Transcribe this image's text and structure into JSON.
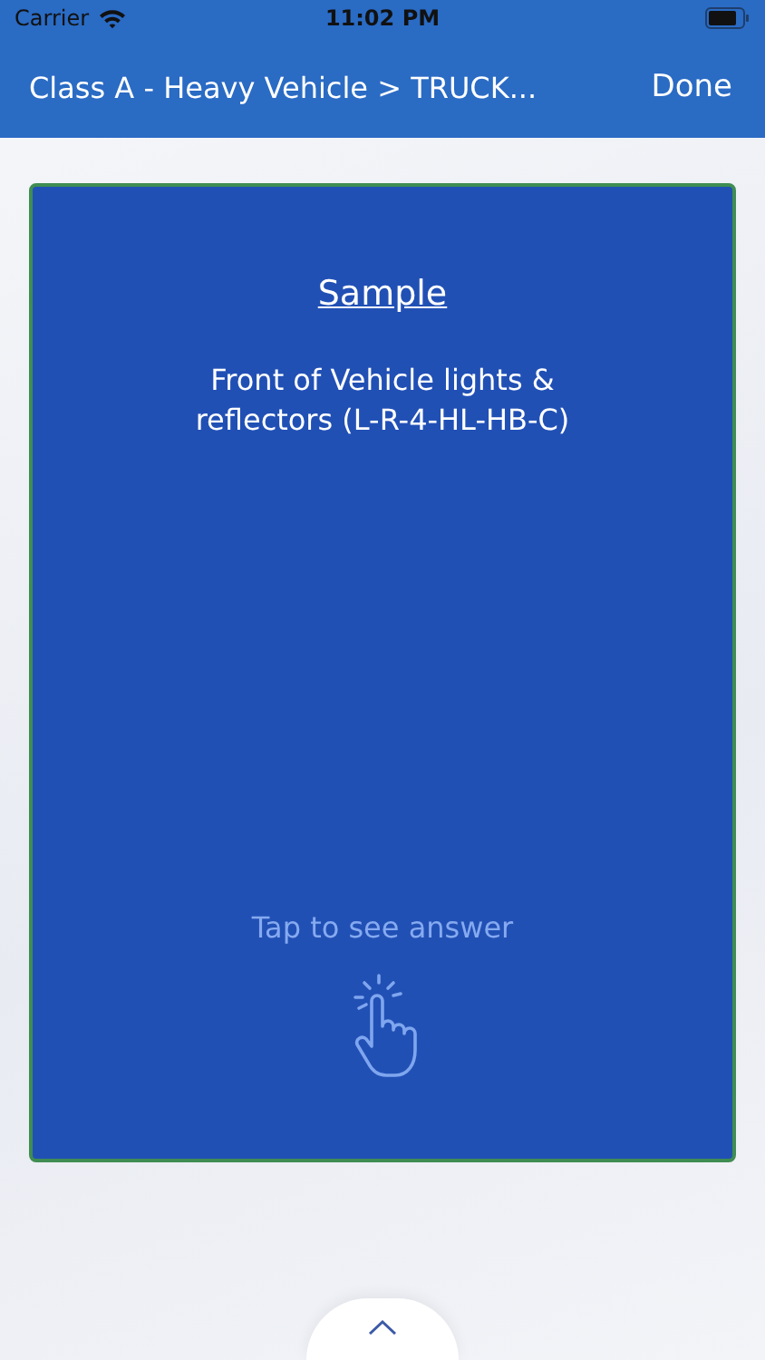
{
  "status_bar": {
    "carrier": "Carrier",
    "time": "11:02 PM"
  },
  "nav_bar": {
    "title": "Class A - Heavy Vehicle > TRUCK...",
    "done": "Done"
  },
  "card": {
    "heading": "Sample",
    "question": "Front of Vehicle lights & reflectors (L-R-4-HL-HB-C)",
    "hint": "Tap to see answer"
  }
}
